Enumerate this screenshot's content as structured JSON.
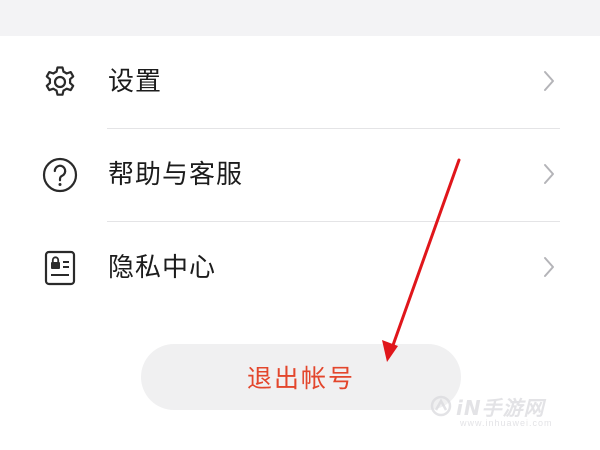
{
  "menu": {
    "items": [
      {
        "label": "设置",
        "icon": "gear-icon"
      },
      {
        "label": "帮助与客服",
        "icon": "help-circle-icon"
      },
      {
        "label": "隐私中心",
        "icon": "privacy-lock-card-icon"
      }
    ]
  },
  "logout": {
    "label": "退出帐号"
  },
  "watermark": {
    "text": "iN手游网",
    "sub": "www.inhuawei.com"
  },
  "colors": {
    "accent": "#e3462c",
    "arrow": "#e0161b",
    "text": "#1c1c1c",
    "chevron": "#b4b4b8",
    "divider": "#e4e4e6",
    "button_bg": "#f0f0f1"
  }
}
